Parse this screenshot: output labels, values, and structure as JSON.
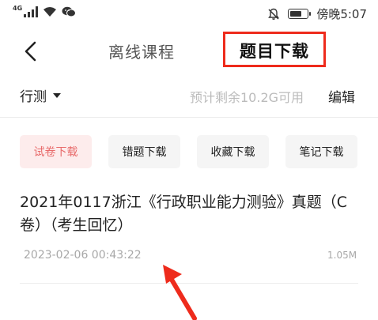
{
  "status_bar": {
    "network": "4G",
    "time": "傍晚5:07"
  },
  "nav": {
    "tab_offline": "离线课程",
    "tab_download": "题目下载"
  },
  "toolbar": {
    "subject": "行测",
    "storage_text": "预计剩余10.2G可用",
    "edit_label": "编辑"
  },
  "chips": [
    {
      "label": "试卷下载"
    },
    {
      "label": "错题下载"
    },
    {
      "label": "收藏下载"
    },
    {
      "label": "笔记下载"
    }
  ],
  "items": [
    {
      "title": "2021年0117浙江《行政职业能力测验》真题（C卷）（考生回忆）",
      "date": "2023-02-06 00:43:22",
      "size": "1.05M"
    }
  ],
  "colors": {
    "highlight_box": "#ee2b1c",
    "active_chip_bg": "#fdecec",
    "active_chip_text": "#e86a6a",
    "arrow": "#ee2b1c"
  }
}
